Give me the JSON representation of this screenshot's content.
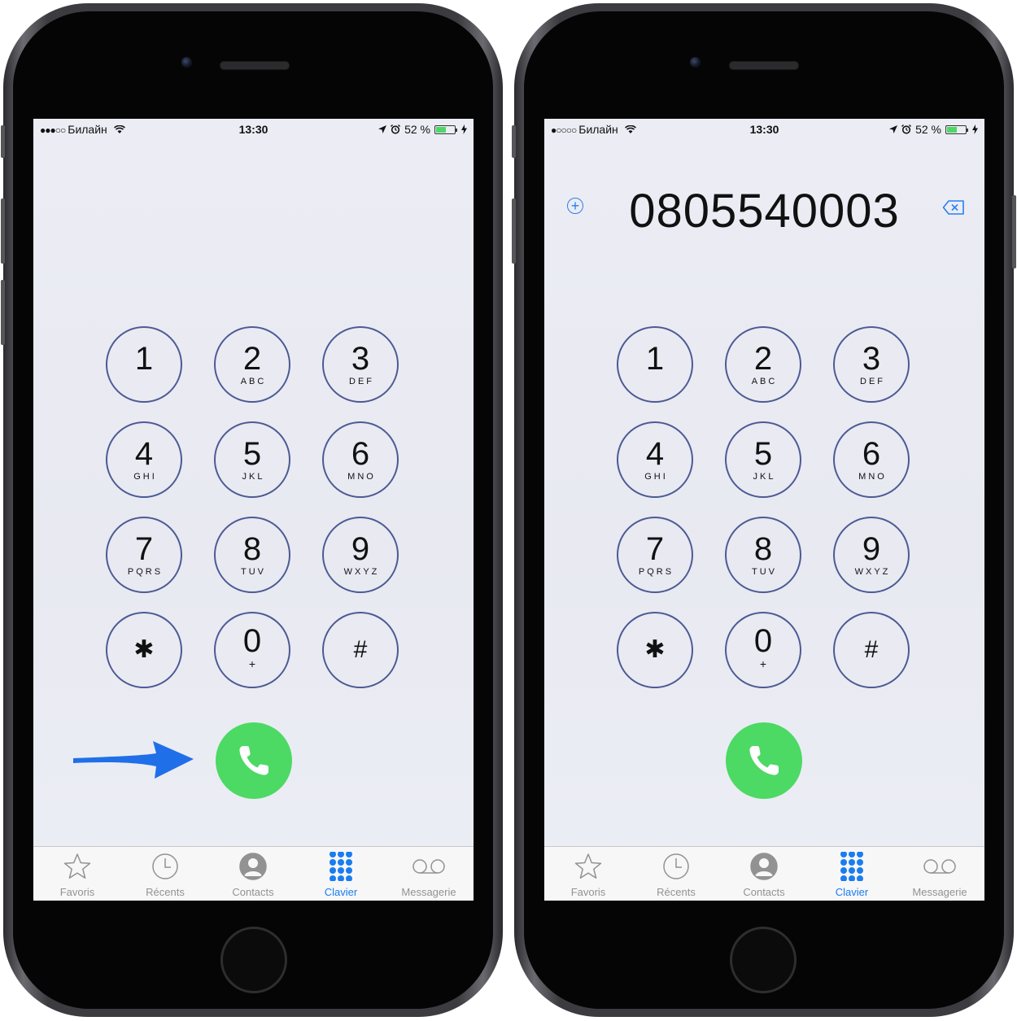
{
  "phones": [
    {
      "status": {
        "signal": "●●●○○",
        "carrier": "Билайн",
        "time": "13:30",
        "battery": "52 %",
        "battery_level": 0.52
      },
      "number": "",
      "keypad": [
        {
          "digit": "1",
          "letters": ""
        },
        {
          "digit": "2",
          "letters": "ABC"
        },
        {
          "digit": "3",
          "letters": "DEF"
        },
        {
          "digit": "4",
          "letters": "GHI"
        },
        {
          "digit": "5",
          "letters": "JKL"
        },
        {
          "digit": "6",
          "letters": "MNO"
        },
        {
          "digit": "7",
          "letters": "PQRS"
        },
        {
          "digit": "8",
          "letters": "TUV"
        },
        {
          "digit": "9",
          "letters": "WXYZ"
        },
        {
          "digit": "✱",
          "letters": ""
        },
        {
          "digit": "0",
          "letters": "+"
        },
        {
          "digit": "#",
          "letters": ""
        }
      ],
      "tabs": [
        {
          "label": "Favoris",
          "icon": "star-icon"
        },
        {
          "label": "Récents",
          "icon": "clock-icon"
        },
        {
          "label": "Contacts",
          "icon": "person-icon"
        },
        {
          "label": "Clavier",
          "icon": "keypad-icon",
          "active": true
        },
        {
          "label": "Messagerie",
          "icon": "voicemail-icon"
        }
      ]
    },
    {
      "status": {
        "signal": "●○○○○",
        "carrier": "Билайн",
        "time": "13:30",
        "battery": "52 %",
        "battery_level": 0.52
      },
      "number": "0805540003",
      "add_symbol": "+",
      "keypad": [
        {
          "digit": "1",
          "letters": ""
        },
        {
          "digit": "2",
          "letters": "ABC"
        },
        {
          "digit": "3",
          "letters": "DEF"
        },
        {
          "digit": "4",
          "letters": "GHI"
        },
        {
          "digit": "5",
          "letters": "JKL"
        },
        {
          "digit": "6",
          "letters": "MNO"
        },
        {
          "digit": "7",
          "letters": "PQRS"
        },
        {
          "digit": "8",
          "letters": "TUV"
        },
        {
          "digit": "9",
          "letters": "WXYZ"
        },
        {
          "digit": "✱",
          "letters": ""
        },
        {
          "digit": "0",
          "letters": "+"
        },
        {
          "digit": "#",
          "letters": ""
        }
      ],
      "tabs": [
        {
          "label": "Favoris",
          "icon": "star-icon"
        },
        {
          "label": "Récents",
          "icon": "clock-icon"
        },
        {
          "label": "Contacts",
          "icon": "person-icon"
        },
        {
          "label": "Clavier",
          "icon": "keypad-icon",
          "active": true
        },
        {
          "label": "Messagerie",
          "icon": "voicemail-icon"
        }
      ]
    }
  ],
  "colors": {
    "call_green": "#4cd964",
    "accent_blue": "#1a7cf0",
    "key_ring": "#4c5a93",
    "arrow_blue": "#1f6fe8"
  },
  "annotation": {
    "icon": "arrow-right-icon"
  }
}
